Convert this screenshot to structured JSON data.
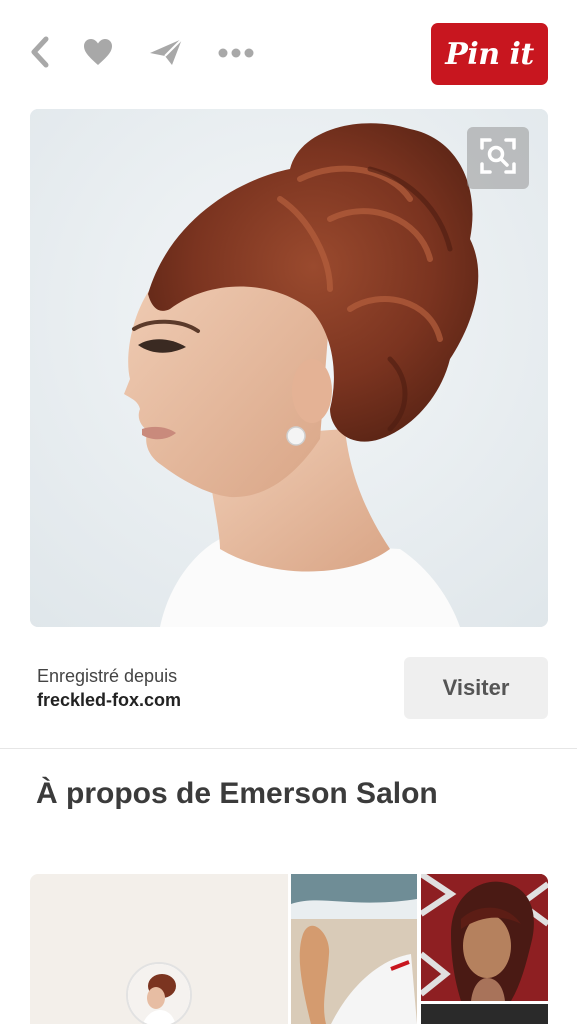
{
  "toolbar": {
    "back_icon": "chevron-left-icon",
    "like_icon": "heart-icon",
    "send_icon": "paper-plane-icon",
    "more_icon": "ellipsis-icon",
    "pin_label": "Pin it"
  },
  "hero": {
    "zoom_icon": "visual-search-icon"
  },
  "source": {
    "saved_from": "Enregistré depuis",
    "domain": "freckled-fox.com",
    "visit_label": "Visiter"
  },
  "about": {
    "title": "À propos de Emerson Salon"
  },
  "colors": {
    "brand_red": "#c8161f",
    "icon_gray": "#a8a8a8",
    "visit_bg": "#efefef"
  }
}
